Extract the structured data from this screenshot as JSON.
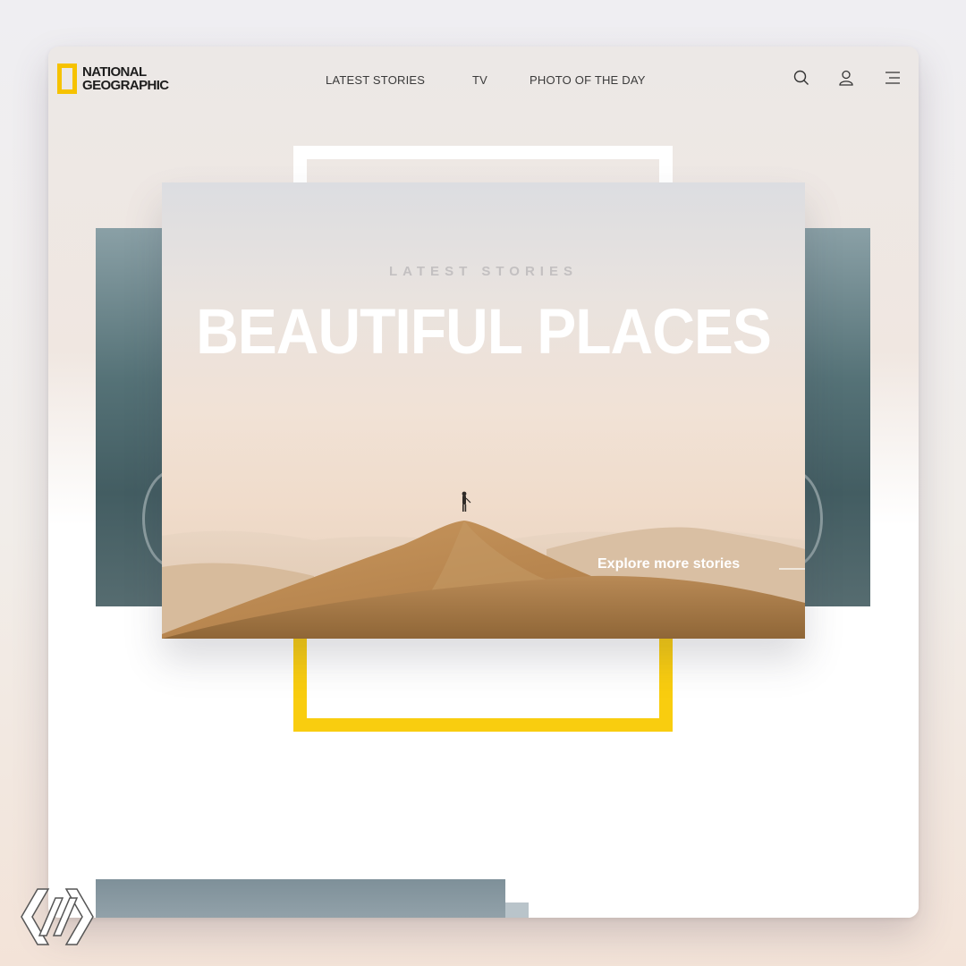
{
  "brand": {
    "line1": "NATIONAL",
    "line2": "GEOGRAPHIC",
    "accent": "#f9cd0f"
  },
  "nav": {
    "items": [
      {
        "label": "LATEST STORIES"
      },
      {
        "label": "TV"
      },
      {
        "label": "PHOTO OF THE DAY"
      }
    ]
  },
  "header_icons": [
    "search-icon",
    "user-icon",
    "menu-icon"
  ],
  "hero": {
    "eyebrow": "LATEST STORIES",
    "title": "BEAUTIFUL PLACES",
    "cta": "Explore more stories"
  }
}
